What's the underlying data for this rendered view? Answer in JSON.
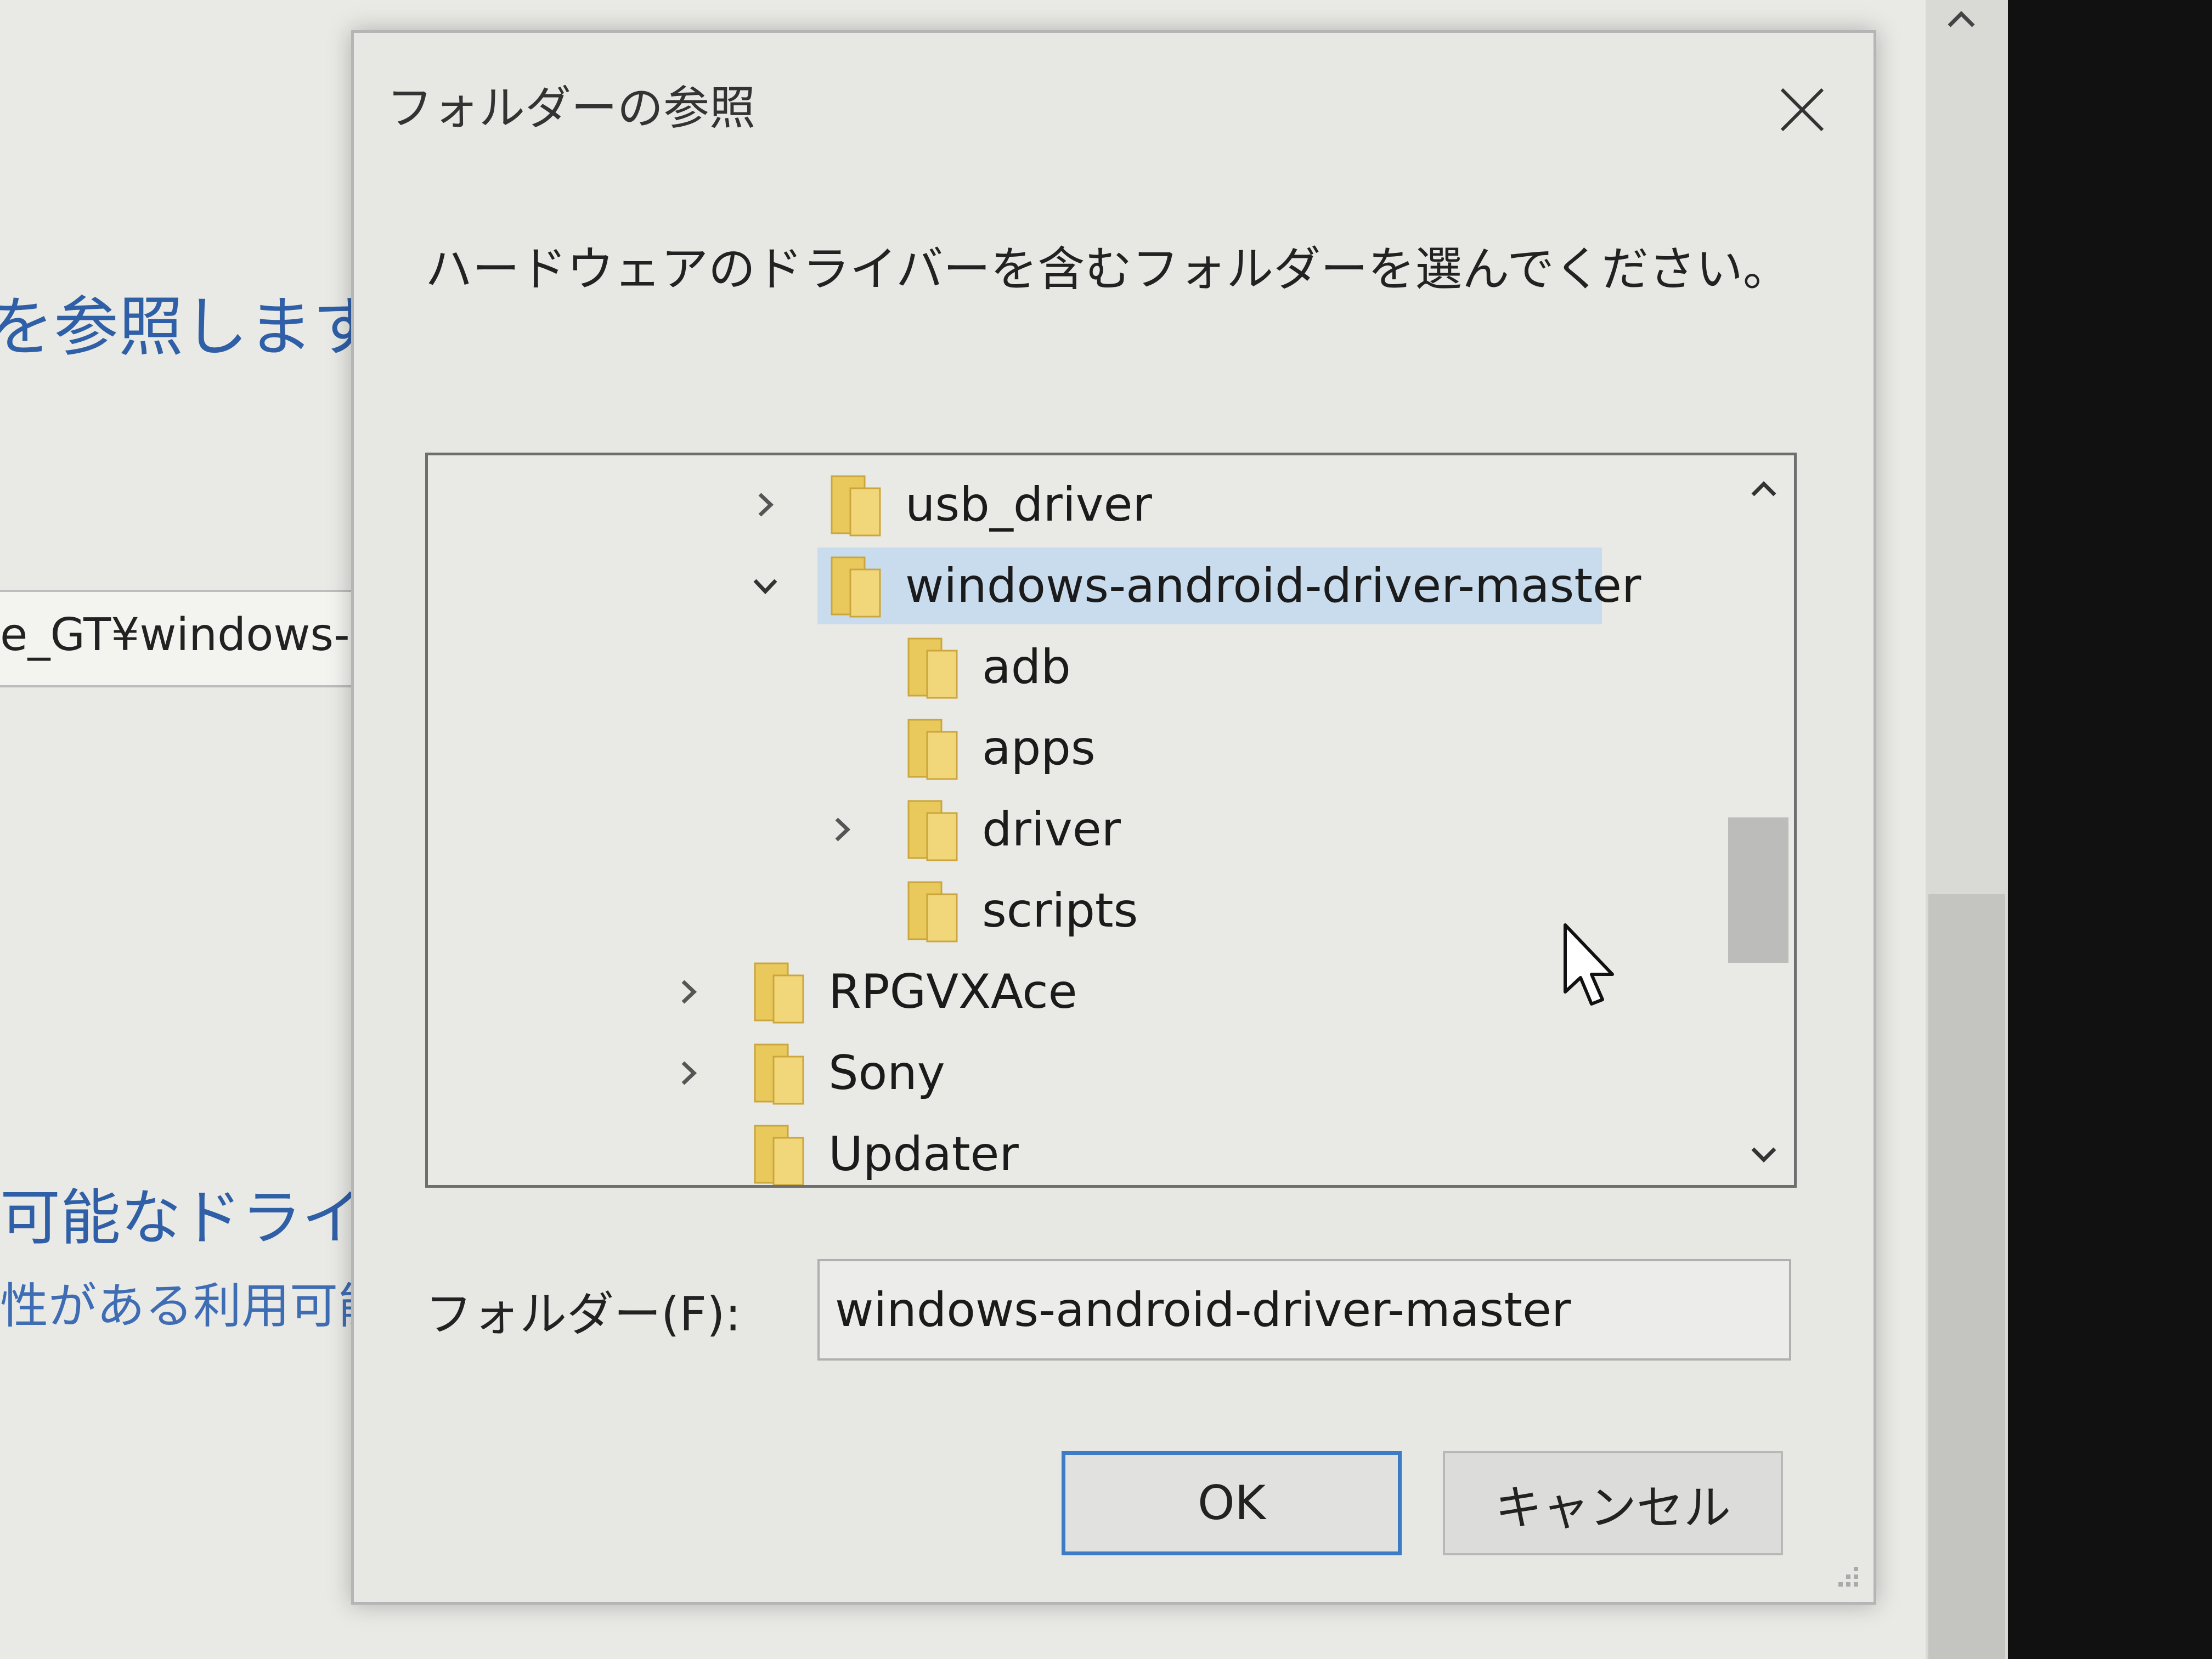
{
  "background": {
    "heading_fragment": "を参照します。",
    "path_fragment": "e_GT¥windows-a",
    "link_fragment_1": "可能なドライバ",
    "link_fragment_2": "性がある利用可能"
  },
  "dialog": {
    "title": "フォルダーの参照",
    "instruction": "ハードウェアのドライバーを含むフォルダーを選んでください。",
    "tree": {
      "items": [
        {
          "label": "usb_driver",
          "expander": "collapsed"
        },
        {
          "label": "windows-android-driver-master",
          "expander": "expanded",
          "selected": true
        },
        {
          "label": "adb",
          "expander": "none"
        },
        {
          "label": "apps",
          "expander": "none"
        },
        {
          "label": "driver",
          "expander": "collapsed"
        },
        {
          "label": "scripts",
          "expander": "none"
        },
        {
          "label": "RPGVXAce",
          "expander": "collapsed"
        },
        {
          "label": "Sony",
          "expander": "collapsed"
        },
        {
          "label": "Updater",
          "expander": "none"
        }
      ]
    },
    "folder_label": "フォルダー(F):",
    "folder_value": "windows-android-driver-master",
    "ok_label": "OK",
    "cancel_label": "キャンセル"
  },
  "colors": {
    "selection": "#c9dcee",
    "folder": "#e9c95b",
    "link": "#2f5fa6",
    "ok_border": "#3d7bc6"
  }
}
